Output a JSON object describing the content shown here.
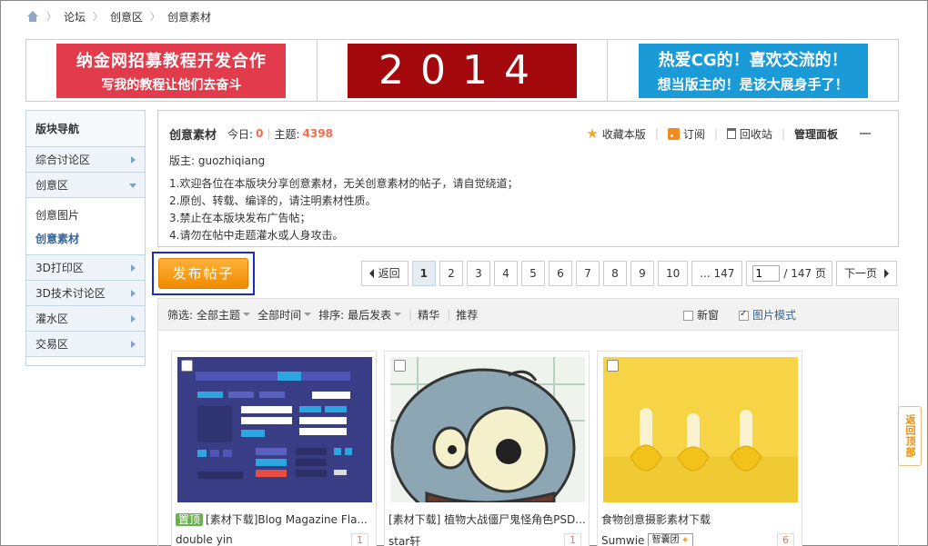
{
  "breadcrumb": [
    "论坛",
    "创意区",
    "创意素材"
  ],
  "banners": [
    {
      "line1": "纳金网招募教程开发合作",
      "line2": "写我的教程让他们去奋斗",
      "bg": "#e23b4b"
    },
    {
      "line1": "2014",
      "bg": "#a3080c"
    },
    {
      "line1": "热爱CG的！喜欢交流的！",
      "line2": "想当版主的！是该大展身手了！",
      "bg": "#1a9bd7"
    }
  ],
  "sidebar": {
    "title": "版块导航",
    "items": [
      {
        "label": "综合讨论区",
        "expanded": false
      },
      {
        "label": "创意区",
        "expanded": true
      },
      {
        "label": "3D打印区",
        "expanded": false
      },
      {
        "label": "3D技术讨论区",
        "expanded": false
      },
      {
        "label": "灌水区",
        "expanded": false
      },
      {
        "label": "交易区",
        "expanded": false
      }
    ],
    "subitems": [
      {
        "label": "创意图片",
        "active": false
      },
      {
        "label": "创意素材",
        "active": true
      }
    ]
  },
  "forum": {
    "name": "创意素材",
    "today_label": "今日:",
    "today_value": "0",
    "topics_label": "主题:",
    "topics_value": "4398",
    "moderator": "版主: guozhiqiang",
    "rules": [
      "1.欢迎各位在本版块分享创意素材，无关创意素材的帖子，请自觉绕道；",
      "2.原创、转载、编译的，请注明素材性质。",
      "3.禁止在本版块发布广告帖；",
      "4.请勿在帖中走题灌水或人身攻击。"
    ],
    "actions": {
      "favorite": "收藏本版",
      "subscribe": "订阅",
      "recycle": "回收站",
      "manage": "管理面板"
    }
  },
  "post_button": "发布帖子",
  "pager": {
    "back": "返回",
    "pages": [
      "1",
      "2",
      "3",
      "4",
      "5",
      "6",
      "7",
      "8",
      "9",
      "10"
    ],
    "last": "... 147",
    "input_value": "1",
    "total": "/ 147 页",
    "next": "下一页",
    "current": "1"
  },
  "filter": {
    "label": "筛选:",
    "theme": "全部主题",
    "time": "全部时间",
    "sort_label": "排序:",
    "sort": "最后发表",
    "digest": "精华",
    "recommend": "推荐",
    "new_window": "新窗",
    "image_mode": "图片模式"
  },
  "cards": [
    {
      "badge": "置顶",
      "title": "[素材下载]Blog Magazine Fla...",
      "author": "double yin",
      "count": "1"
    },
    {
      "badge": "",
      "title": "[素材下载] 植物大战僵尸鬼怪角色PSD...",
      "author": "star轩",
      "count": "1"
    },
    {
      "badge": "",
      "title": "食物创意摄影素材下载",
      "author": "Sumwie",
      "medal": "智囊团",
      "count": "6"
    }
  ],
  "back_to_top": "返回顶部"
}
